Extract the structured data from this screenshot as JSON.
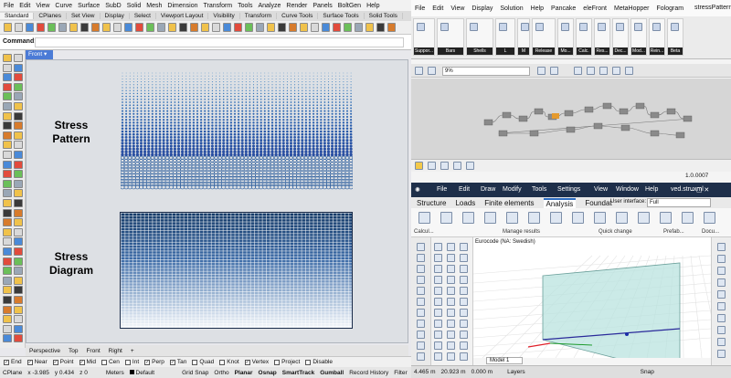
{
  "rhino": {
    "menu": [
      "File",
      "Edit",
      "View",
      "Curve",
      "Surface",
      "SubD",
      "Solid",
      "Mesh",
      "Dimension",
      "Transform",
      "Tools",
      "Analyze",
      "Render",
      "Panels",
      "BoltGen",
      "Help"
    ],
    "toolbar_tabs": [
      "Standard",
      "CPlanes",
      "Set View",
      "Display",
      "Select",
      "Viewport Layout",
      "Visibility",
      "Transform",
      "Curve Tools",
      "Surface Tools",
      "Solid Tools"
    ],
    "command_label": "Command:",
    "command_value": "",
    "viewport_name": "Front",
    "stress_pattern_line1": "Stress",
    "stress_pattern_line2": "Pattern",
    "stress_diagram_line1": "Stress",
    "stress_diagram_line2": "Diagram",
    "view_tabs": [
      "Perspective",
      "Top",
      "Front",
      "Right"
    ],
    "snaps": [
      {
        "label": "End",
        "checked": true
      },
      {
        "label": "Near",
        "checked": true
      },
      {
        "label": "Point",
        "checked": true
      },
      {
        "label": "Mid",
        "checked": true
      },
      {
        "label": "Cen",
        "checked": false
      },
      {
        "label": "Int",
        "checked": false
      },
      {
        "label": "Perp",
        "checked": true
      },
      {
        "label": "Tan",
        "checked": true
      },
      {
        "label": "Quad",
        "checked": false
      },
      {
        "label": "Knot",
        "checked": false
      },
      {
        "label": "Vertex",
        "checked": true
      },
      {
        "label": "Project",
        "checked": false
      },
      {
        "label": "Disable",
        "checked": false
      }
    ],
    "status": {
      "cplane": "CPlane",
      "x": "x -3.985",
      "y": "y 0.434",
      "z": "z 0",
      "units": "Meters",
      "layer": "Default",
      "grid_snap": "Grid Snap",
      "ortho": "Ortho",
      "planar": "Planar",
      "osnap": "Osnap",
      "smarttrack": "SmartTrack",
      "gumball": "Gumball",
      "record_history": "Record History",
      "filter": "Filter"
    }
  },
  "grasshopper": {
    "menu": [
      "File",
      "Edit",
      "View",
      "Display",
      "Solution",
      "Help",
      "Pancake",
      "eleFront",
      "MetaHopper",
      "Fologram"
    ],
    "file_title": "stressPattern",
    "ribbon_groups": [
      "Suppor...",
      "Bars",
      "Shells",
      "L",
      "M",
      "Release",
      "Mo...",
      "Calc.",
      "Res...",
      "Dec...",
      "Mod...",
      "Rein...",
      "Beta"
    ],
    "zoom": "9%",
    "version": "1.0.0007"
  },
  "fem": {
    "menu": [
      "File",
      "Edit",
      "Draw",
      "Modify",
      "Tools",
      "Settings",
      "View",
      "Window",
      "Help"
    ],
    "file_title": "ved.struxml",
    "tabs": [
      "Structure",
      "Loads",
      "Finite elements",
      "Analysis",
      "Foundat"
    ],
    "active_tab": "Analysis",
    "ui_label": "User interface:",
    "ui_value": "Full",
    "ribbon_labels": [
      "Calcul...",
      "Manage results",
      "Quick change",
      "Prefab...",
      "Docu..."
    ],
    "code": "Eurocode (NA: Swedish)",
    "model_tab": "Model 1",
    "status": {
      "v1": "4.465 m",
      "v2": "20.923 m",
      "v3": "0.000 m",
      "layers": "Layers",
      "snap": "Snap"
    }
  },
  "colors": {
    "rhino_active_viewport": "#4b7bd6",
    "stress_dark": "#123866",
    "stress_light": "#f3f6fa",
    "fem_title": "#1e2f4a",
    "fem_slab": "#b9e3df"
  }
}
